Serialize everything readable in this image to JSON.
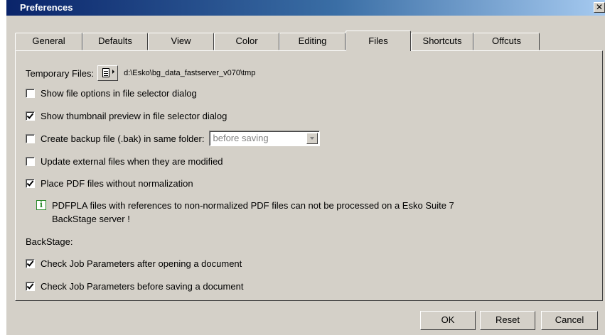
{
  "window": {
    "title": "Preferences",
    "close_glyph": "✕"
  },
  "tabs": [
    {
      "label": "General"
    },
    {
      "label": "Defaults"
    },
    {
      "label": "View"
    },
    {
      "label": "Color"
    },
    {
      "label": "Editing"
    },
    {
      "label": "Files",
      "active": true
    },
    {
      "label": "Shortcuts"
    },
    {
      "label": "Offcuts"
    }
  ],
  "files": {
    "temp_label": "Temporary Files:",
    "temp_path": "d:\\Esko\\bg_data_fastserver_v070\\tmp",
    "options": {
      "show_file_options": {
        "label": "Show file options in file selector dialog",
        "checked": false
      },
      "show_thumbnail": {
        "label": "Show thumbnail preview in file selector dialog",
        "checked": true
      },
      "create_backup": {
        "label": "Create backup file (.bak) in same folder:",
        "checked": false
      },
      "update_external": {
        "label": "Update external files when they are modified",
        "checked": false
      },
      "place_pdf": {
        "label": "Place PDF files without normalization",
        "checked": true
      }
    },
    "backup_select_value": "before saving",
    "info_icon": "info-icon",
    "info_line1": "PDFPLA files with references to non-normalized PDF files can not be processed on a Esko Suite 7",
    "info_line2": "BackStage server !",
    "backstage_label": "BackStage:",
    "backstage": {
      "check_after_open": {
        "label": "Check Job Parameters after opening a document",
        "checked": true
      },
      "check_before_save": {
        "label": "Check Job Parameters before saving a document",
        "checked": true
      }
    }
  },
  "buttons": {
    "ok": "OK",
    "reset": "Reset",
    "cancel": "Cancel"
  }
}
